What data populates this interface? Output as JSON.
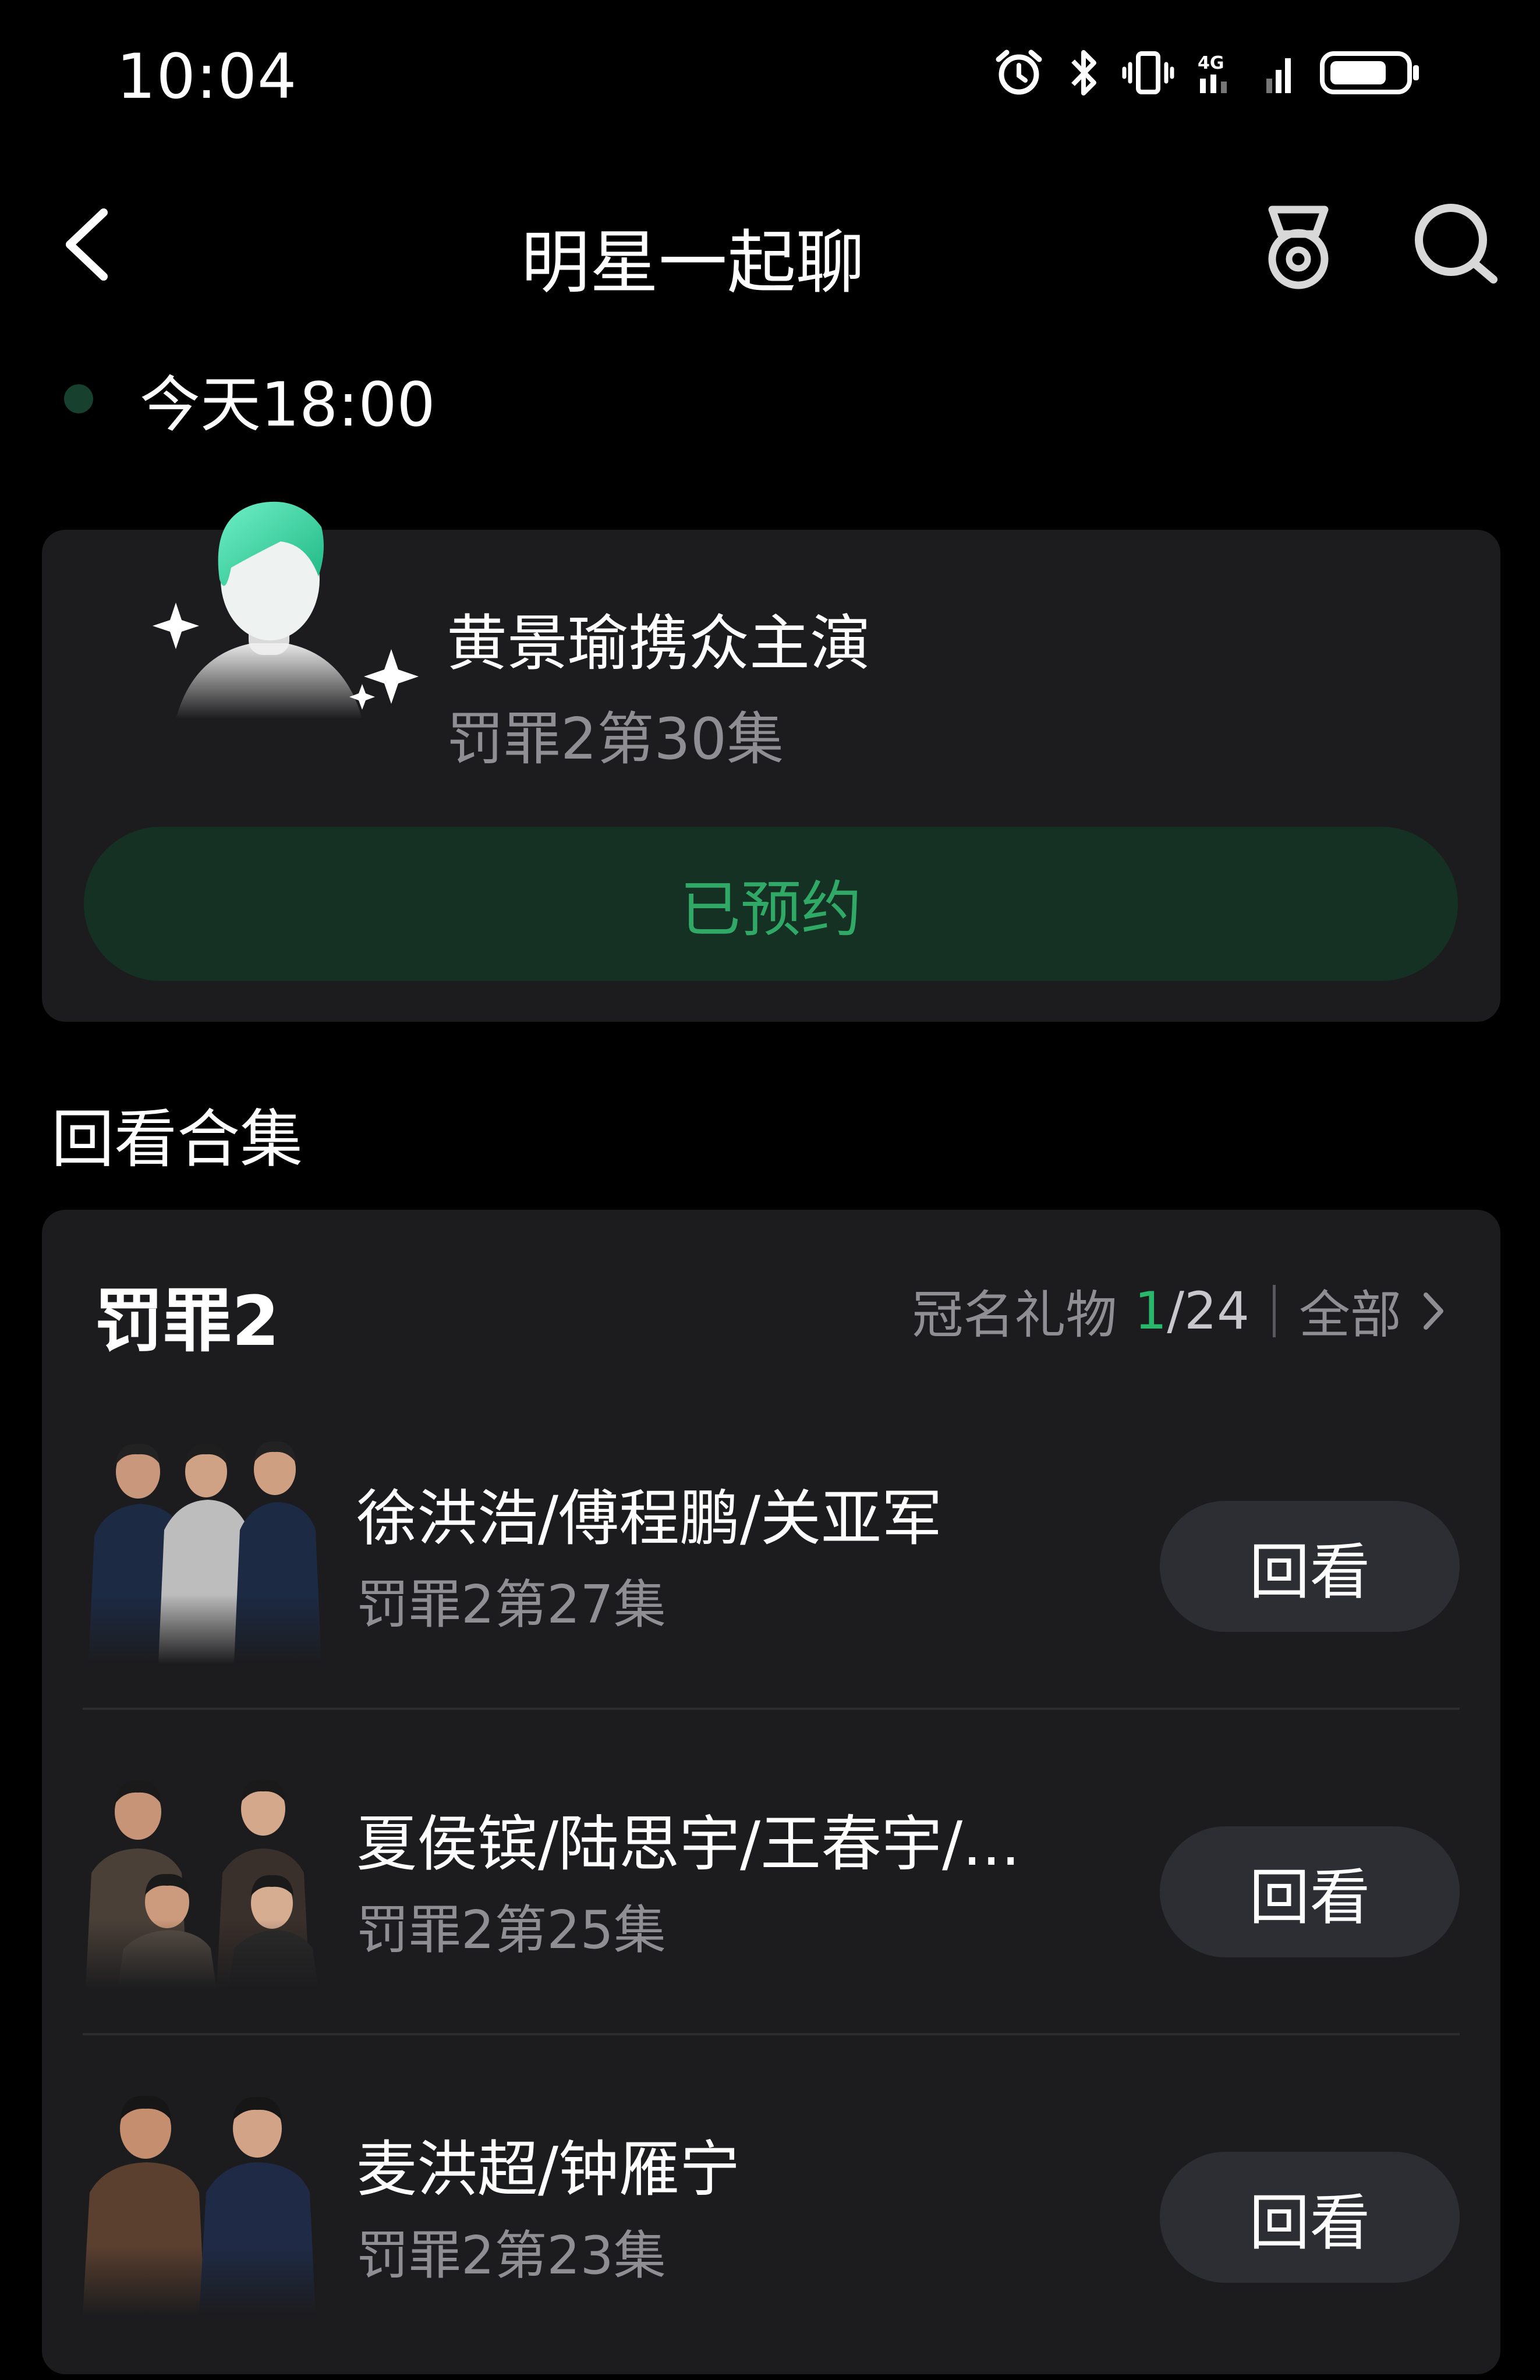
{
  "status_bar": {
    "time": "10:04",
    "icons": [
      "alarm-icon",
      "bluetooth-icon",
      "vibrate-icon",
      "signal-4g-icon",
      "signal-icon",
      "battery-icon"
    ]
  },
  "header": {
    "title": "明星一起聊",
    "back_icon": "chevron-left-icon",
    "medal_icon": "medal-icon",
    "search_icon": "search-icon"
  },
  "schedule": {
    "time_label": "今天18:00"
  },
  "live_card": {
    "title": "黄景瑜携众主演",
    "subtitle": "罚罪2第30集",
    "reserve_label": "已预约"
  },
  "section": {
    "title": "回看合集"
  },
  "collection": {
    "show_name": "罚罪2",
    "gift_label": "冠名礼物",
    "gift_count": "1",
    "gift_total": "/24",
    "all_label": "全部",
    "episodes": [
      {
        "name": "徐洪浩/傅程鹏/关亚军",
        "subtitle": "罚罪2第27集",
        "button": "回看"
      },
      {
        "name": "夏侯镔/陆思宇/王春宇/...",
        "subtitle": "罚罪2第25集",
        "button": "回看"
      },
      {
        "name": "麦洪超/钟雁宁",
        "subtitle": "罚罪2第23集",
        "button": "回看"
      }
    ]
  },
  "colors": {
    "background": "#000000",
    "card": "#1c1c1e",
    "accent_green": "#2fa965",
    "reserve_bg": "#153124",
    "muted_text": "#8e8e93"
  }
}
